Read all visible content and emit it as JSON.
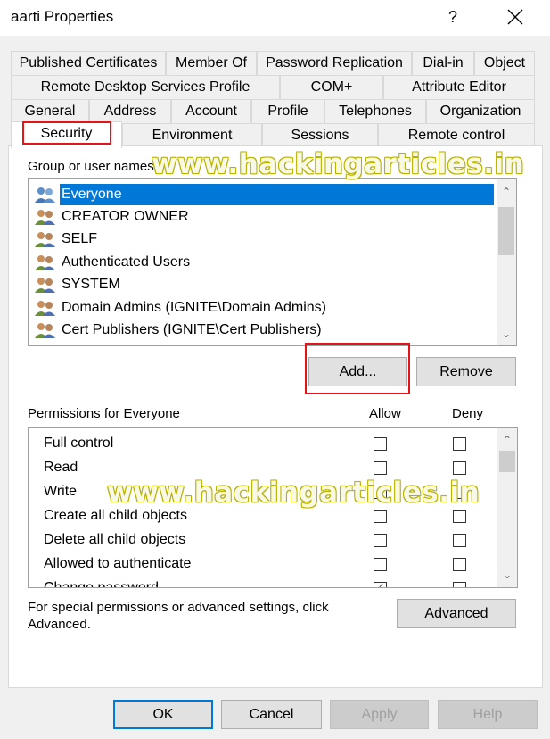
{
  "window": {
    "title": "aarti Properties",
    "help_label": "?",
    "close_icon": "close-icon"
  },
  "tabs": {
    "row1": [
      "Published Certificates",
      "Member Of",
      "Password Replication",
      "Dial-in",
      "Object"
    ],
    "row2": [
      "Remote Desktop Services Profile",
      "COM+",
      "Attribute Editor"
    ],
    "row3": [
      "General",
      "Address",
      "Account",
      "Profile",
      "Telephones",
      "Organization"
    ],
    "row4": [
      "Security",
      "Environment",
      "Sessions",
      "Remote control"
    ],
    "active": "Security"
  },
  "groups": {
    "label": "Group or user names:",
    "items": [
      {
        "name": "Everyone",
        "selected": true
      },
      {
        "name": "CREATOR OWNER"
      },
      {
        "name": "SELF"
      },
      {
        "name": "Authenticated Users"
      },
      {
        "name": "SYSTEM"
      },
      {
        "name": "Domain Admins (IGNITE\\Domain Admins)"
      },
      {
        "name": "Cert Publishers (IGNITE\\Cert Publishers)"
      }
    ],
    "add_label": "Add...",
    "remove_label": "Remove"
  },
  "permissions": {
    "label": "Permissions for Everyone",
    "allow_header": "Allow",
    "deny_header": "Deny",
    "items": [
      {
        "name": "Full control",
        "allow": false,
        "deny": false
      },
      {
        "name": "Read",
        "allow": false,
        "deny": false
      },
      {
        "name": "Write",
        "allow": false,
        "deny": false
      },
      {
        "name": "Create all child objects",
        "allow": false,
        "deny": false
      },
      {
        "name": "Delete all child objects",
        "allow": false,
        "deny": false
      },
      {
        "name": "Allowed to authenticate",
        "allow": false,
        "deny": false
      },
      {
        "name": "Change password",
        "allow": true,
        "deny": false
      }
    ]
  },
  "special": {
    "text_line1": "For special permissions or advanced settings, click",
    "text_line2": "Advanced.",
    "advanced_label": "Advanced"
  },
  "footer": {
    "ok_label": "OK",
    "cancel_label": "Cancel",
    "apply_label": "Apply",
    "help_label": "Help"
  },
  "watermark": "www.hackingarticles.in",
  "colors": {
    "selection": "#0078d7",
    "highlight_box": "#e3151a"
  }
}
